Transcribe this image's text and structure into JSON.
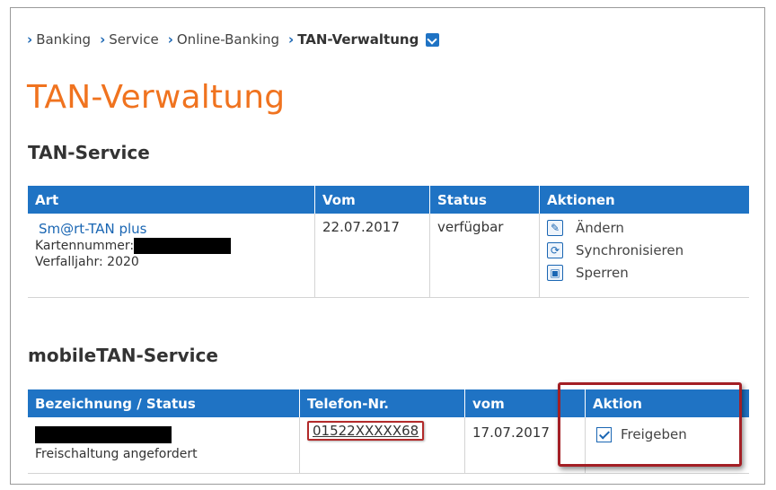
{
  "breadcrumb": {
    "items": [
      "Banking",
      "Service",
      "Online-Banking",
      "TAN-Verwaltung"
    ]
  },
  "page_title": "TAN-Verwaltung",
  "tan_service": {
    "title": "TAN-Service",
    "headers": [
      "Art",
      "Vom",
      "Status",
      "Aktionen"
    ],
    "row": {
      "product_link": "Sm@rt-TAN plus",
      "card_number_label": "Kartennummer:",
      "expiry": "Verfalljahr: 2020",
      "from": "22.07.2017",
      "status": "verfügbar",
      "actions": [
        {
          "label": "Ändern",
          "icon": "pencil-icon"
        },
        {
          "label": "Synchronisieren",
          "icon": "sync-icon"
        },
        {
          "label": "Sperren",
          "icon": "lock-icon"
        }
      ]
    }
  },
  "mobile_tan_service": {
    "title": "mobileTAN-Service",
    "headers": [
      "Bezeichnung / Status",
      "Telefon-Nr.",
      "vom",
      "Aktion"
    ],
    "row": {
      "status_text": "Freischaltung angefordert",
      "phone": "01522XXXXX68",
      "from": "17.07.2017",
      "action_label": "Freigeben",
      "action_checked": true
    }
  },
  "colors": {
    "accent_blue": "#1f73c4",
    "title_orange": "#f0731f",
    "highlight_red": "#a31f25"
  }
}
